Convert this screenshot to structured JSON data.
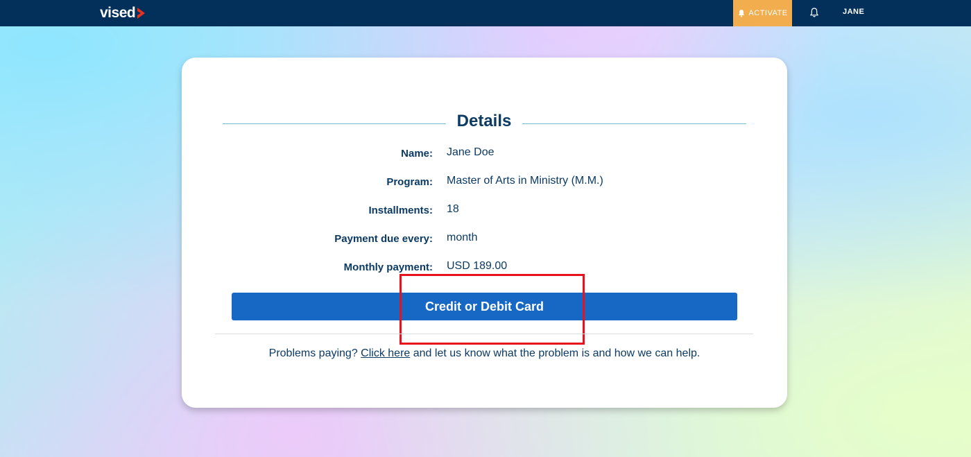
{
  "header": {
    "logo_text": "vised",
    "activate_label": "ACTIVATE",
    "user_name": "JANE",
    "icons": [
      "bell-icon",
      "chevron-logo-icon"
    ],
    "colors": {
      "bar": "#03305a",
      "activate": "#f2ad4e",
      "accent": "#e8311f"
    }
  },
  "details": {
    "title": "Details",
    "rows": [
      {
        "label": "Name:",
        "value": "Jane Doe"
      },
      {
        "label": "Program:",
        "value": "Master of Arts in Ministry (M.M.)"
      },
      {
        "label": "Installments:",
        "value": "18"
      },
      {
        "label": "Payment due every:",
        "value": "month"
      },
      {
        "label": "Monthly payment:",
        "value": "USD 189.00"
      }
    ]
  },
  "payment": {
    "button_label": "Credit or Debit Card",
    "button_color": "#1767c4"
  },
  "help": {
    "prefix": "Problems paying? ",
    "link": "Click here",
    "suffix": " and let us know what the problem is and how we can help."
  }
}
